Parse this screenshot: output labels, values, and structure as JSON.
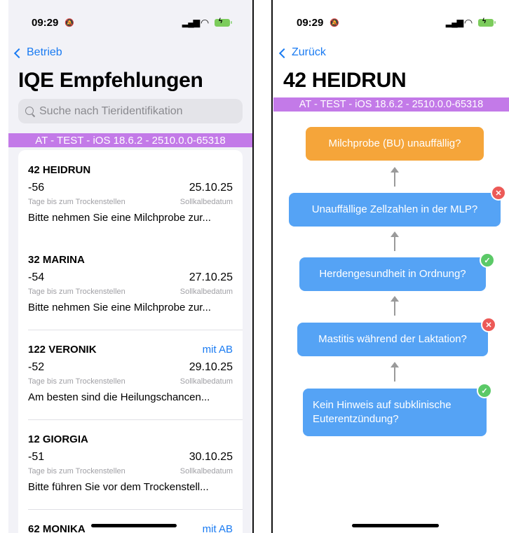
{
  "status_bar": {
    "time": "09:29"
  },
  "left": {
    "back_label": "Betrieb",
    "title": "IQE Empfehlungen",
    "search_placeholder": "Suche nach Tieridentifikation",
    "banner": "AT - TEST - iOS 18.6.2 - 2510.0.0-65318",
    "labels": {
      "days": "Tage bis zum Trockenstellen",
      "date": "Sollkalbedatum"
    },
    "entries": [
      {
        "name": "42 HEIDRUN",
        "badge": "",
        "days": "-56",
        "date": "25.10.25",
        "message": "Bitte nehmen Sie eine Milchprobe zur..."
      },
      {
        "name": "32 MARINA",
        "badge": "",
        "days": "-54",
        "date": "27.10.25",
        "message": "Bitte nehmen Sie eine Milchprobe zur..."
      },
      {
        "name": "122 VERONIK",
        "badge": "mit AB",
        "days": "-52",
        "date": "29.10.25",
        "message": "Am besten sind die Heilungschancen..."
      },
      {
        "name": "12 GIORGIA",
        "badge": "",
        "days": "-51",
        "date": "30.10.25",
        "message": "Bitte führen Sie vor dem Trockenstell..."
      },
      {
        "name": "62 MONIKA",
        "badge": "mit AB",
        "days": "",
        "date": "",
        "message": ""
      }
    ]
  },
  "right": {
    "back_label": "Zurück",
    "title": "42 HEIDRUN",
    "banner": "AT - TEST - iOS 18.6.2 - 2510.0.0-65318",
    "nodes": [
      {
        "label": "Milchprobe (BU) unauffällig?",
        "color": "#f5a53a",
        "status": ""
      },
      {
        "label": "Unauffällige Zellzahlen in der MLP?",
        "color": "#55a3f5",
        "status": "fail"
      },
      {
        "label": "Herdengesundheit in Ordnung?",
        "color": "#55a3f5",
        "status": "pass"
      },
      {
        "label": "Mastitis während der Laktation?",
        "color": "#55a3f5",
        "status": "fail"
      },
      {
        "label": "Kein Hinweis auf subklinische Euterentzündung?",
        "color": "#55a3f5",
        "status": "pass"
      }
    ]
  },
  "icons": {
    "fail": "✕",
    "pass": "✓"
  }
}
